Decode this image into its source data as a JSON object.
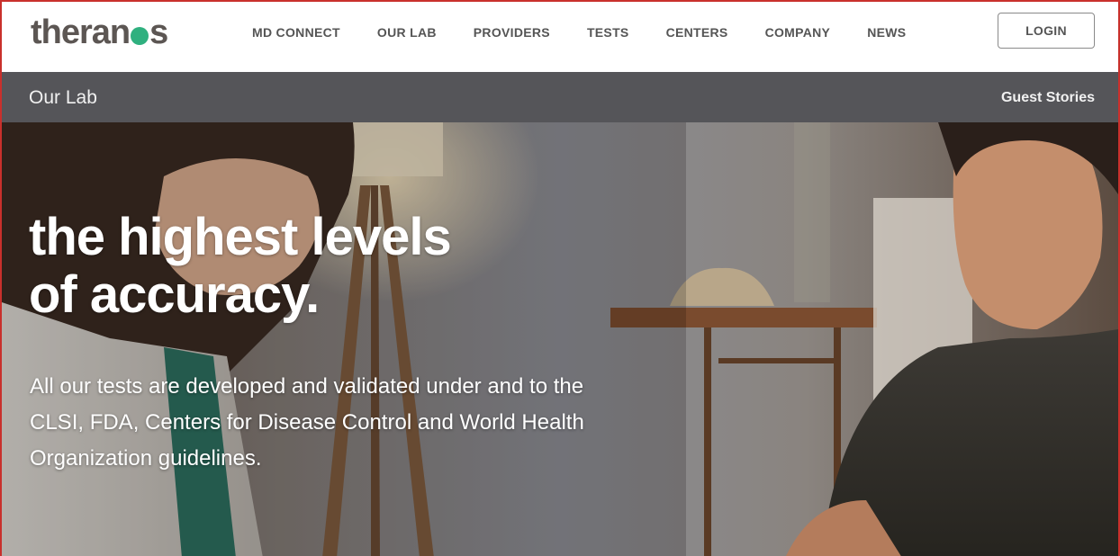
{
  "brand": {
    "logo_before": "theran",
    "logo_after": "s",
    "accent_color": "#2fb07f"
  },
  "nav": {
    "items": [
      {
        "label": "MD CONNECT"
      },
      {
        "label": "OUR LAB"
      },
      {
        "label": "PROVIDERS"
      },
      {
        "label": "TESTS"
      },
      {
        "label": "CENTERS"
      },
      {
        "label": "COMPANY"
      },
      {
        "label": "NEWS"
      }
    ],
    "login_label": "LOGIN"
  },
  "subnav": {
    "title": "Our Lab",
    "link_label": "Guest Stories"
  },
  "hero": {
    "headline_line1": "the highest levels",
    "headline_line2": "of accuracy.",
    "body_line1": "All our tests are developed and validated under and to the",
    "body_line2": "CLSI, FDA, Centers for Disease Control and World Health",
    "body_line3": "Organization guidelines."
  }
}
